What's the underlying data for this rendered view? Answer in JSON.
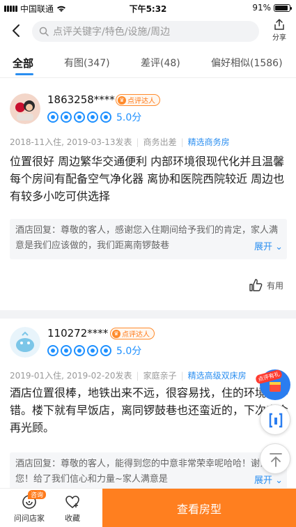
{
  "status_bar": {
    "carrier": "中国联通",
    "time": "下午5:32",
    "battery": "91%",
    "battery_level": 0.91
  },
  "header": {
    "search_placeholder": "点评关键字/特色/设施/周边",
    "share_label": "分享"
  },
  "tabs": [
    {
      "label": "全部",
      "active": true
    },
    {
      "label": "有图(347)"
    },
    {
      "label": "差评(48)"
    },
    {
      "label": "偏好相似(1586)"
    }
  ],
  "reviews": [
    {
      "username": "1863258****",
      "badge": "点评达人",
      "score": "5.0分",
      "rating_value": 5,
      "date_info": "2018-11入住, 2019-03-13发表",
      "trip_type": "商务出差",
      "room_type": "精选商务房",
      "content": "位置很好 周边繁华交通便利 内部环境很现代化并且温馨 每个房间有配备空气净化器 离协和医院西院较近 周边也有较多小吃可供选择",
      "reply": "酒店回复：尊敬的客人，感谢您入住期间给予我们的肯定，家人满意是我们应该做的，我们距离南锣鼓巷",
      "expand": "展开",
      "useful": "有用"
    },
    {
      "username": "110272****",
      "badge": "点评达人",
      "score": "5.0分",
      "rating_value": 5,
      "date_info": "2019-01入住, 2019-02-20发表",
      "trip_type": "家庭亲子",
      "room_type": "精选高级双床房",
      "content": "酒店位置很棒，地铁出来不远，很容易找，住的环境也不错。楼下就有早饭店，离同锣鼓巷也还蛮近的，下次来会再光顾。",
      "reply": "酒店回复：尊敬的客人，能得到您的中意非常荣幸呢哈哈！谢谢您！给了我们信心和力量~家人满意是",
      "expand": "展开"
    }
  ],
  "floating": {
    "gift_label": "点评有礼"
  },
  "bottom_bar": {
    "consult_tag": "咨询",
    "ask_label": "问问店家",
    "fav_label": "收藏",
    "room_button": "查看房型"
  }
}
